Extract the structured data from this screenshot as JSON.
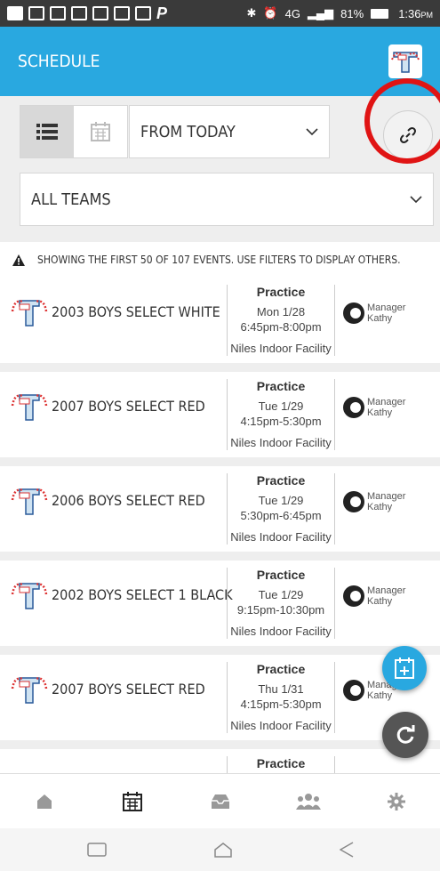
{
  "status_bar": {
    "network": "4G",
    "battery": "81%",
    "time": "1:36",
    "ampm": "PM"
  },
  "app_bar": {
    "title": "SCHEDULE"
  },
  "filters": {
    "date_range": "FROM TODAY",
    "team_filter": "ALL TEAMS"
  },
  "notice": "SHOWING THE FIRST 50 OF 107 EVENTS. USE FILTERS TO DISPLAY OTHERS.",
  "events": [
    {
      "team": "2003 BOYS SELECT WHITE",
      "type": "Practice",
      "date": "Mon 1/28",
      "time": "6:45pm-8:00pm",
      "location": "Niles Indoor Facility",
      "role": "Manager",
      "person": "Kathy"
    },
    {
      "team": "2007 BOYS SELECT RED",
      "type": "Practice",
      "date": "Tue 1/29",
      "time": "4:15pm-5:30pm",
      "location": "Niles Indoor Facility",
      "role": "Manager",
      "person": "Kathy"
    },
    {
      "team": "2006 BOYS SELECT RED",
      "type": "Practice",
      "date": "Tue 1/29",
      "time": "5:30pm-6:45pm",
      "location": "Niles Indoor Facility",
      "role": "Manager",
      "person": "Kathy"
    },
    {
      "team": "2002 BOYS SELECT 1 BLACK",
      "type": "Practice",
      "date": "Tue 1/29",
      "time": "9:15pm-10:30pm",
      "location": "Niles Indoor Facility",
      "role": "Manager",
      "person": "Kathy"
    },
    {
      "team": "2007 BOYS SELECT RED",
      "type": "Practice",
      "date": "Thu 1/31",
      "time": "4:15pm-5:30pm",
      "location": "Niles Indoor Facility",
      "role": "Manager",
      "person": "Kathy"
    },
    {
      "team": "",
      "type": "Practice",
      "date": "",
      "time": "",
      "location": "",
      "role": "",
      "person": ""
    }
  ],
  "colors": {
    "app_bar": "#29a8e0",
    "fab_add": "#29a8e0",
    "fab_refresh": "#555555",
    "highlight_ring": "#e01414"
  },
  "icons": {
    "list_view": "list-icon",
    "calendar_view": "calendar-icon",
    "link": "link-icon",
    "add_event": "calendar-plus-icon",
    "refresh": "refresh-icon",
    "tabs": [
      "home-icon",
      "calendar-icon",
      "inbox-icon",
      "people-icon",
      "gear-icon"
    ]
  }
}
